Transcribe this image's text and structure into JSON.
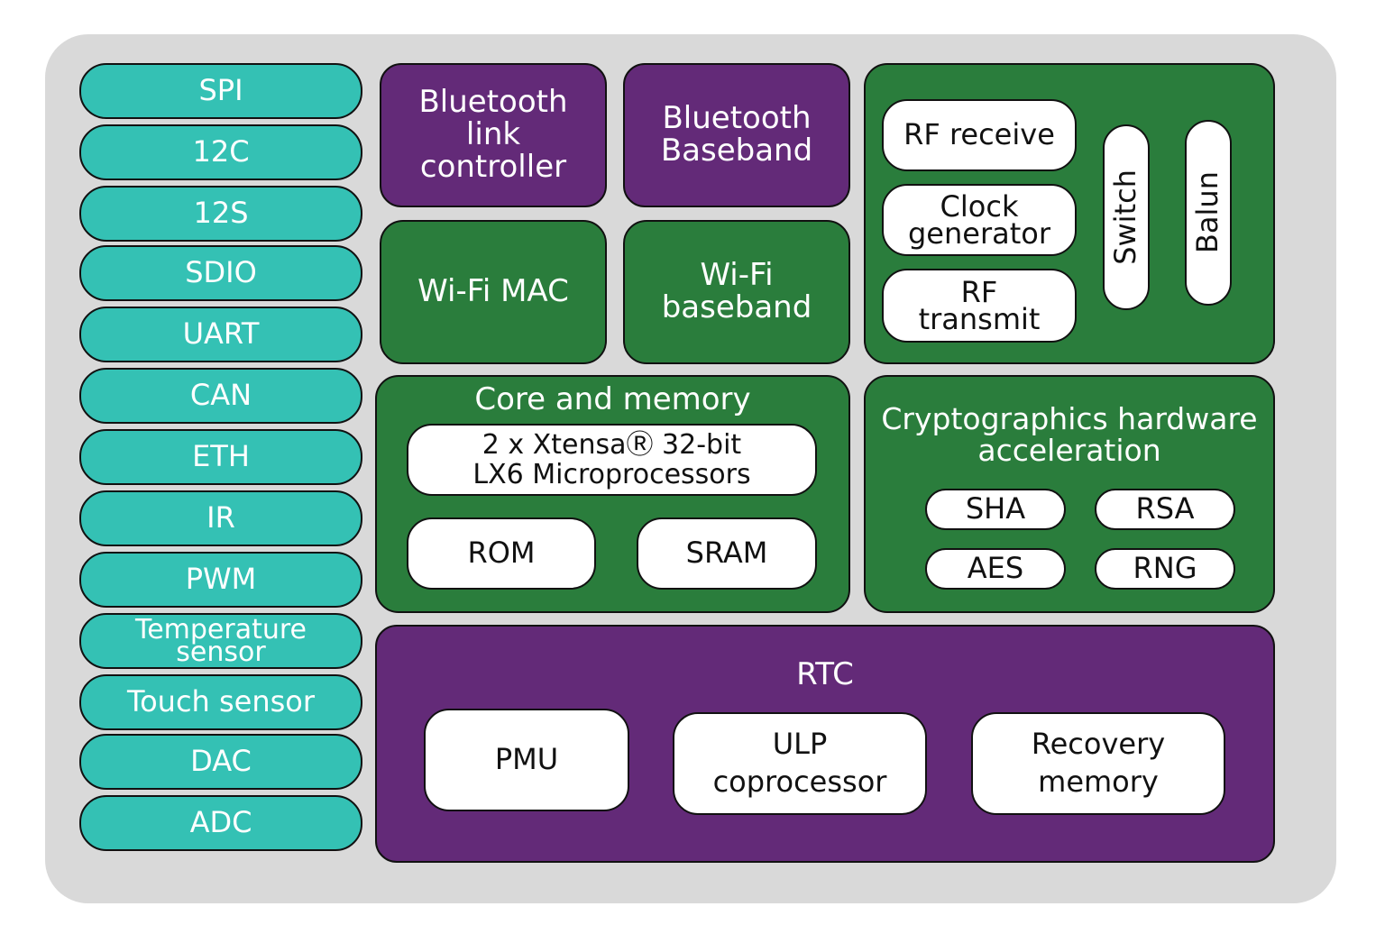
{
  "colors": {
    "background": "#d9d9d9",
    "peripheral": "#34c1b4",
    "radio_bt": "#632a78",
    "block_green": "#2a7d3c",
    "inner": "#ffffff",
    "outline": "#111111"
  },
  "peripherals": [
    "SPI",
    "12C",
    "12S",
    "SDIO",
    "UART",
    "CAN",
    "ETH",
    "IR",
    "PWM",
    "Temperature sensor",
    "Touch sensor",
    "DAC",
    "ADC"
  ],
  "bluetooth_link_controller": "Bluetooth link controller",
  "bluetooth_baseband": "Bluetooth Baseband",
  "wifi_mac": "Wi-Fi MAC",
  "wifi_baseband": "Wi-Fi baseband",
  "rf": {
    "receive": "RF receive",
    "clock": "Clock generator",
    "transmit": "RF transmit",
    "switch": "Switch",
    "balun": "Balun"
  },
  "core": {
    "title": "Core and memory",
    "cpu": "2 x XtensaⓇ 32-bit LX6 Microprocessors",
    "rom": "ROM",
    "sram": "SRAM"
  },
  "crypto": {
    "title": "Cryptographics hardware acceleration",
    "sha": "SHA",
    "rsa": "RSA",
    "aes": "AES",
    "rng": "RNG"
  },
  "rtc": {
    "title": "RTC",
    "pmu": "PMU",
    "ulp": "ULP coprocessor",
    "recovery": "Recovery memory"
  }
}
